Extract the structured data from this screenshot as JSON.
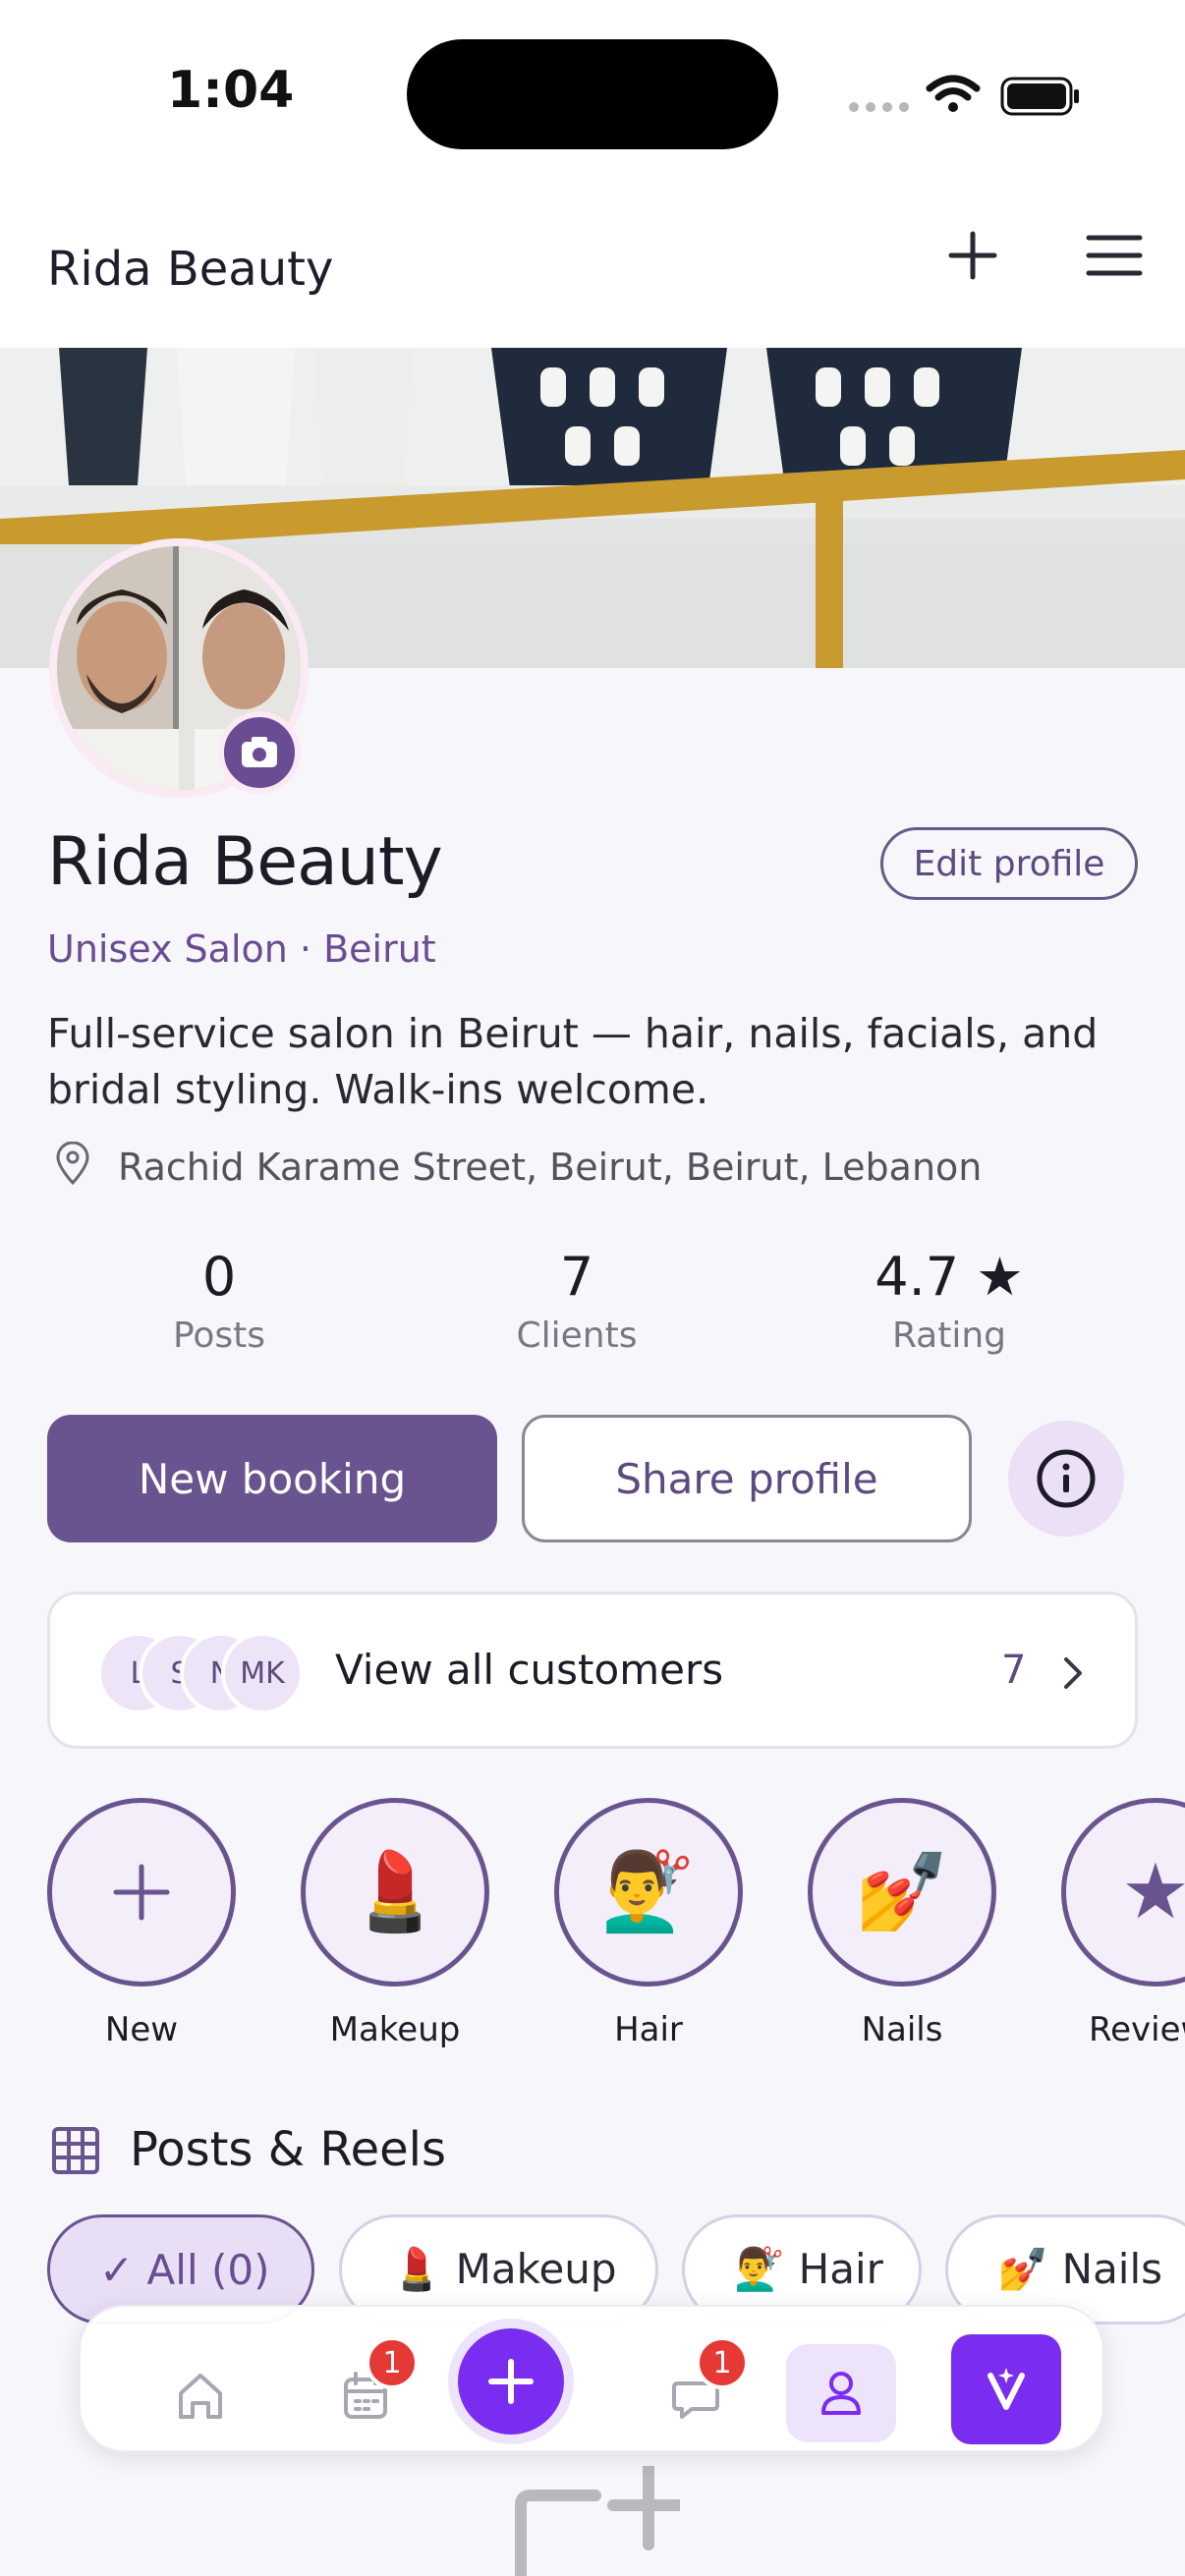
{
  "status_bar": {
    "time": "1:04"
  },
  "header": {
    "title": "Rida Beauty",
    "icons": [
      "plus-icon",
      "hamburger-menu-icon"
    ]
  },
  "profile": {
    "name": "Rida Beauty",
    "edit_label": "Edit profile",
    "category": "Unisex Salon · Beirut",
    "bio": "Full-service salon in Beirut — hair, nails, facials, and bridal styling. Walk-ins welcome.",
    "location": "Rachid Karame Street, Beirut, Beirut, Lebanon"
  },
  "stats": [
    {
      "value": "0",
      "label": "Posts"
    },
    {
      "value": "7",
      "label": "Clients"
    },
    {
      "value": "4.7 ★",
      "label": "Rating"
    }
  ],
  "actions": {
    "primary": "New booking",
    "secondary": "Share profile"
  },
  "customers": {
    "avatars": [
      "L",
      "S",
      "N",
      "MK"
    ],
    "label": "View all customers",
    "count": "7"
  },
  "highlights": [
    {
      "label": "New",
      "icon": "+"
    },
    {
      "label": "Makeup",
      "icon": "💄"
    },
    {
      "label": "Hair",
      "icon": "💇‍♂️"
    },
    {
      "label": "Nails",
      "icon": "💅"
    },
    {
      "label": "Reviews",
      "icon": "★"
    }
  ],
  "posts": {
    "title": "Posts & Reels",
    "filters": [
      "✓  All (0)",
      "💄  Makeup",
      "💇‍♂️  Hair",
      "💅  Nails"
    ]
  },
  "tabbar": {
    "calendar_badge": "1",
    "messages_badge": "1"
  },
  "colors": {
    "accent": "#6a5490",
    "fab": "#7a2cf0",
    "badge": "#e53935"
  }
}
